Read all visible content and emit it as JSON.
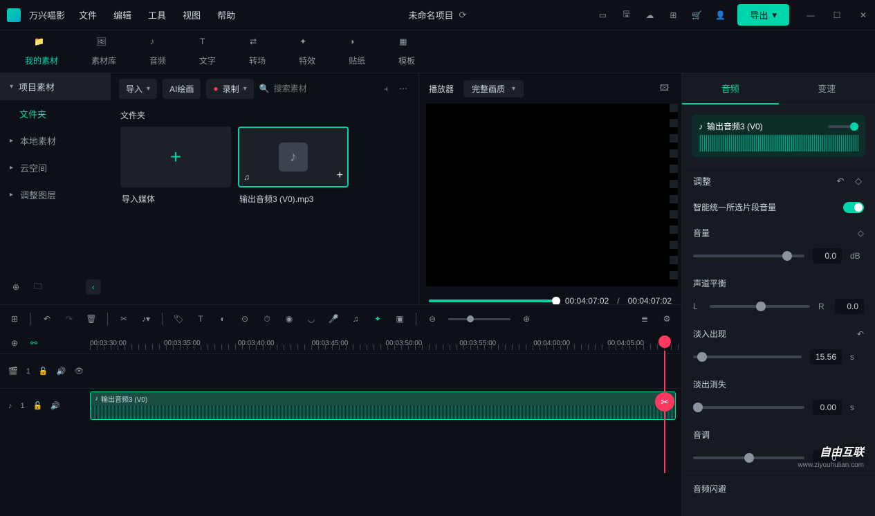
{
  "titlebar": {
    "app_name": "万兴喵影",
    "menu": [
      "文件",
      "编辑",
      "工具",
      "视图",
      "帮助"
    ],
    "project": "未命名项目",
    "export": "导出"
  },
  "tabs": [
    {
      "label": "我的素材",
      "active": true
    },
    {
      "label": "素材库"
    },
    {
      "label": "音频"
    },
    {
      "label": "文字"
    },
    {
      "label": "转场"
    },
    {
      "label": "特效"
    },
    {
      "label": "贴纸"
    },
    {
      "label": "模板"
    }
  ],
  "sidebar": {
    "header": "项目素材",
    "sub": "文件夹",
    "items": [
      "本地素材",
      "云空间",
      "调整图层"
    ]
  },
  "content_tb": {
    "import": "导入",
    "ai": "AI绘画",
    "record": "录制",
    "search_ph": "搜索素材"
  },
  "content": {
    "folder_label": "文件夹",
    "cards": [
      {
        "label": "导入媒体",
        "type": "add"
      },
      {
        "label": "输出音频3 (V0).mp3",
        "type": "audio",
        "selected": true
      }
    ]
  },
  "preview": {
    "title": "播放器",
    "quality": "完整画质",
    "current": "00:04:07:02",
    "total": "00:04:07:02"
  },
  "right": {
    "tabs": [
      "音频",
      "变速"
    ],
    "clip_name": "输出音频3 (V0)",
    "adjust": "调整",
    "smart_vol": "智能统一所选片段音量",
    "volume": {
      "label": "音量",
      "value": "0.0",
      "unit": "dB"
    },
    "balance": {
      "label": "声道平衡",
      "L": "L",
      "R": "R",
      "value": "0.0"
    },
    "fade_in": {
      "label": "淡入出现",
      "value": "15.56",
      "unit": "s"
    },
    "fade_out": {
      "label": "淡出消失",
      "value": "0.00",
      "unit": "s"
    },
    "pitch": {
      "label": "音调",
      "value": "0"
    },
    "duck": "音频闪避"
  },
  "timeline": {
    "times": [
      "00:03:30:00",
      "00:03:35:00",
      "00:03:40:00",
      "00:03:45:00",
      "00:03:50:00",
      "00:03:55:00",
      "00:04:00:00",
      "00:04:05:00"
    ],
    "track_video": "1",
    "track_audio": "1",
    "clip_label": "输出音频3 (V0)"
  },
  "watermark": {
    "main": "自由互联",
    "sub": "www.ziyouhulian.com"
  }
}
